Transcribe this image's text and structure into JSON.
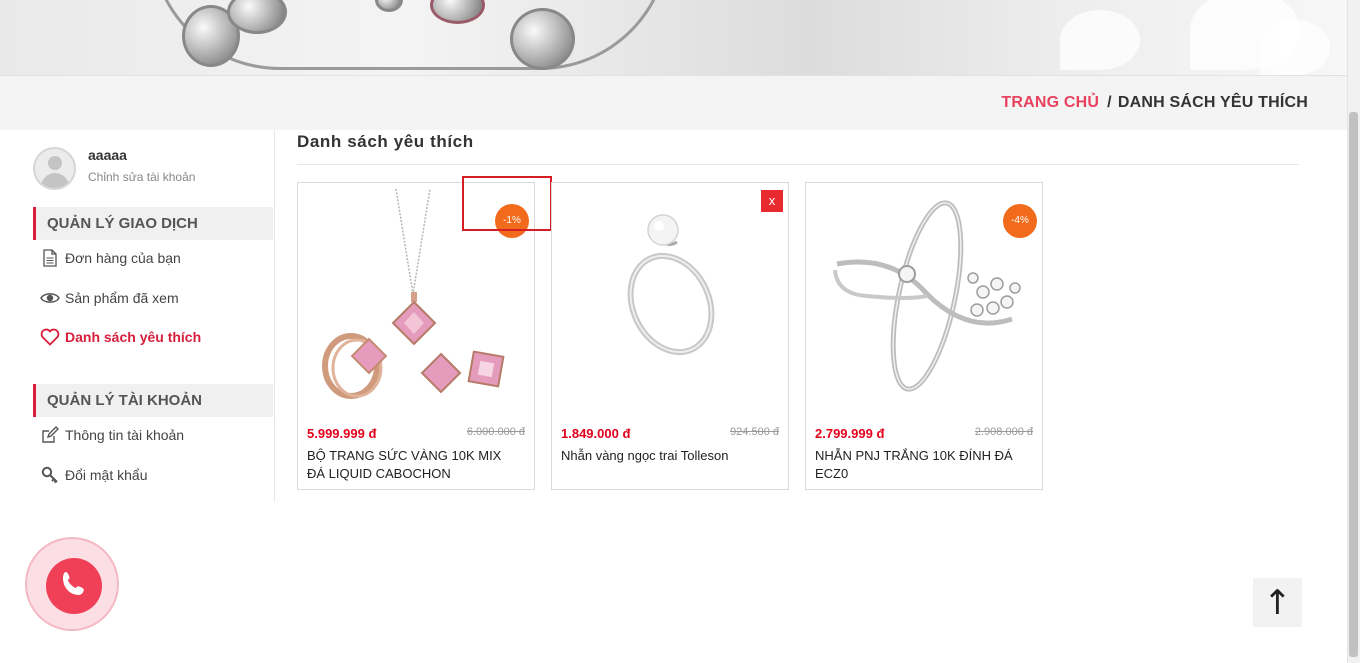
{
  "breadcrumb": {
    "home": "TRANG CHỦ",
    "separator": "/",
    "current": "DANH SÁCH YÊU THÍCH"
  },
  "account": {
    "username": "aaaaa",
    "edit_link": "Chỉnh sửa tài khoản"
  },
  "sidebar": {
    "transactions": {
      "title": "QUẢN LÝ GIAO DỊCH",
      "items": [
        {
          "label": "Đơn hàng của bạn",
          "icon": "document-icon"
        },
        {
          "label": "Sản phẩm đã xem",
          "icon": "eye-icon"
        },
        {
          "label": "Danh sách yêu thích",
          "icon": "heart-icon",
          "active": true
        }
      ]
    },
    "account_mgmt": {
      "title": "QUẢN LÝ TÀI KHOẢN",
      "items": [
        {
          "label": "Thông tin tài khoản",
          "icon": "edit-icon"
        },
        {
          "label": "Đổi mật khẩu",
          "icon": "key-icon"
        }
      ]
    }
  },
  "main": {
    "title": "Danh sách yêu thích",
    "products": [
      {
        "price": "5.999.999 đ",
        "old_price": "6.000.000 đ",
        "name": "BỘ TRANG SỨC VÀNG 10K MIX ĐÁ LIQUID CABOCHON",
        "badge": "-1%"
      },
      {
        "price": "1.849.000 đ",
        "old_price": "924.500 đ",
        "name": "Nhẫn vàng ngọc trai Tolleson",
        "remove": "x"
      },
      {
        "price": "2.799.999 đ",
        "old_price": "2.908.000 đ",
        "name": "NHẪN PNJ TRẮNG 10K ĐÍNH ĐÁ ECZ0",
        "badge": "-4%"
      }
    ]
  },
  "widgets": {
    "back_to_top": "↑",
    "call_icon": "phone-icon"
  },
  "colors": {
    "accent": "#e8425f",
    "sale": "#e3001b",
    "badge": "#f26a1b"
  }
}
